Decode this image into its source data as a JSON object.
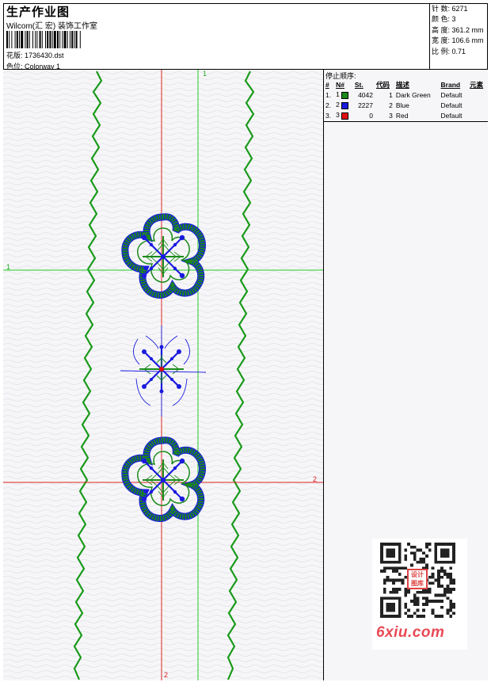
{
  "header": {
    "title": "生产作业图",
    "company": "Wilcom(汇 宏) 装饰工作室",
    "design_label": "花版: 1736430.dst",
    "colorway_label": "色位: Colorway 1"
  },
  "stats": {
    "stitches": "针 数: 6271",
    "colors": "颜 色: 3",
    "height": "高 度: 361.2 mm",
    "width": "宽 度: 106.6 mm",
    "scale": "比 例: 0.71"
  },
  "stop_sequence": {
    "title": "停止顺序:",
    "headers": [
      "#",
      "N#",
      "St.",
      "代码",
      "描述",
      "Brand",
      "元素"
    ],
    "rows": [
      {
        "idx": "1.",
        "n": "1",
        "color": "#1a8a1a",
        "st": "4042",
        "code": "1",
        "desc": "Dark Green",
        "brand": "Default"
      },
      {
        "idx": "2.",
        "n": "2",
        "color": "#1a1adf",
        "st": "2227",
        "code": "2",
        "desc": "Blue",
        "brand": "Default"
      },
      {
        "idx": "3.",
        "n": "3",
        "color": "#e01010",
        "st": "0",
        "code": "3",
        "desc": "Red",
        "brand": "Default"
      }
    ]
  },
  "axes": {
    "v1": "1",
    "h1": "1",
    "h2": "2",
    "v2": "2"
  },
  "watermark": {
    "text": "6xiu.com",
    "stamp": "设计图库"
  },
  "colors": {
    "green": "#1a8a1a",
    "blue": "#1a1adf",
    "red": "#e01010",
    "axis_green": "#22cc22",
    "axis_red": "#dd2222"
  }
}
